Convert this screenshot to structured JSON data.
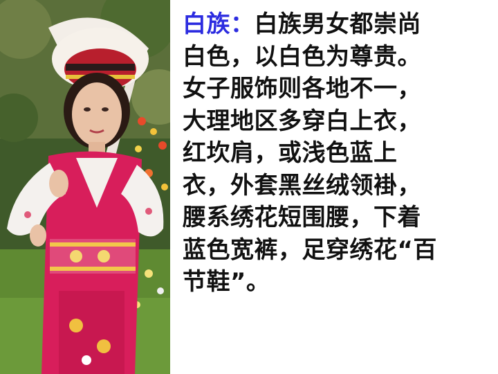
{
  "slide": {
    "heading": "白族：",
    "lines": [
      "白族男女都崇尚",
      "白色，以白色为尊贵。",
      "女子服饰则各地不一，",
      "大理地区多穿白上衣，",
      "红坎肩，或浅色蓝上",
      "衣，外套黑丝绒领褂，",
      "腰系绣花短围腰，下着",
      "蓝色宽裤，足穿绣花“百",
      "节鞋”。"
    ]
  },
  "colors": {
    "heading": "#2c2ce0",
    "body_text": "#111111",
    "background": "#ffffff"
  }
}
